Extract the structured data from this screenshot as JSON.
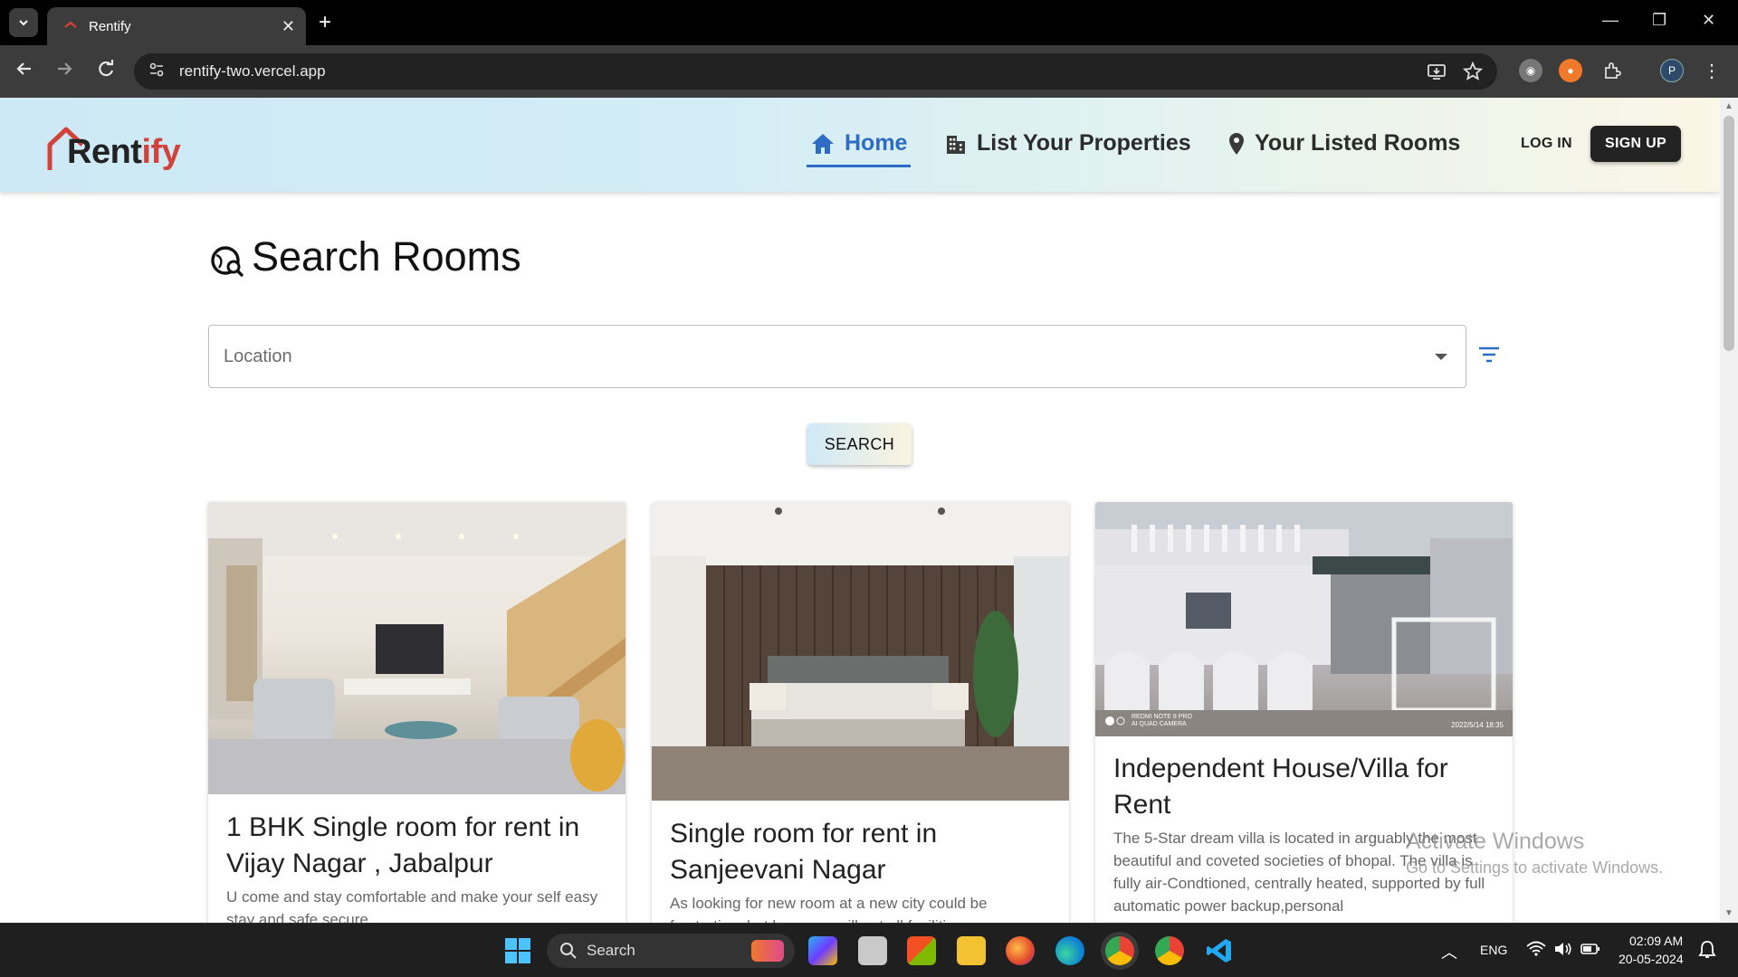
{
  "browser": {
    "tab_title": "Rentify",
    "url": "rentify-two.vercel.app",
    "win_minimize": "—",
    "win_restore": "❐",
    "win_close": "✕",
    "profile_initial": "P"
  },
  "header": {
    "logo_text_main": "Rent",
    "logo_text_accent": "ify",
    "nav": {
      "home": "Home",
      "list_properties": "List Your Properties",
      "listed_rooms": "Your Listed Rooms"
    },
    "login": "LOG IN",
    "signup": "SIGN UP"
  },
  "search": {
    "title": "Search Rooms",
    "location_placeholder": "Location",
    "button": "SEARCH"
  },
  "cards": [
    {
      "title": "1 BHK Single room for rent in Vijay Nagar , Jabalpur",
      "description": "U come and stay comfortable and make your self easy stay and safe secure"
    },
    {
      "title": "Single room for rent in Sanjeevani Nagar",
      "description": "As looking for new room at a new city could be frustrating, but here you will get all facilities"
    },
    {
      "title": "Independent House/Villa for Rent",
      "description": "The 5-Star dream villa is located in arguably the most beautiful and coveted societies of bhopal. The villa is fully air-Condtioned, centrally heated, supported by full automatic power backup,personal"
    }
  ],
  "card3_watermark": {
    "left": "REDMI NOTE 8 PRO",
    "left2": "AI QUAD CAMERA",
    "right": "2022/5/14  18:35"
  },
  "activation": {
    "line1": "Activate Windows",
    "line2": "Go to Settings to activate Windows."
  },
  "taskbar": {
    "search_label": "Search",
    "language": "ENG",
    "time": "02:09 AM",
    "date": "20-05-2024"
  },
  "colors": {
    "accent_blue": "#2d6cc4",
    "logo_red": "#d2413a",
    "signup_bg": "#232323"
  }
}
